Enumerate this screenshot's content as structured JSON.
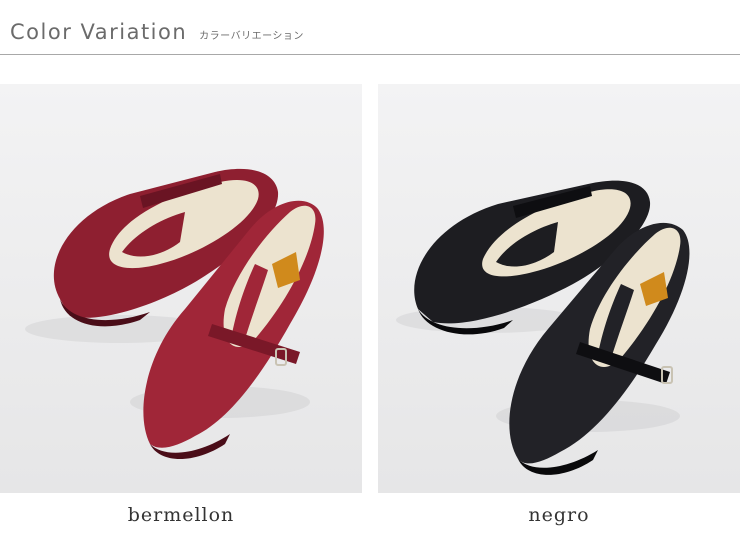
{
  "header": {
    "title": "Color Variation",
    "subtitle": "カラーバリエーション"
  },
  "variants": [
    {
      "name": "bermellon",
      "color": "#8e1f30",
      "shade": "#6a1423",
      "highlight": "#a83445"
    },
    {
      "name": "negro",
      "color": "#1d1d21",
      "shade": "#0e0e11",
      "highlight": "#34343a"
    }
  ],
  "colors": {
    "lining": "#ece3cf",
    "insole": "#e8dcc4",
    "background": "#efeff0"
  }
}
